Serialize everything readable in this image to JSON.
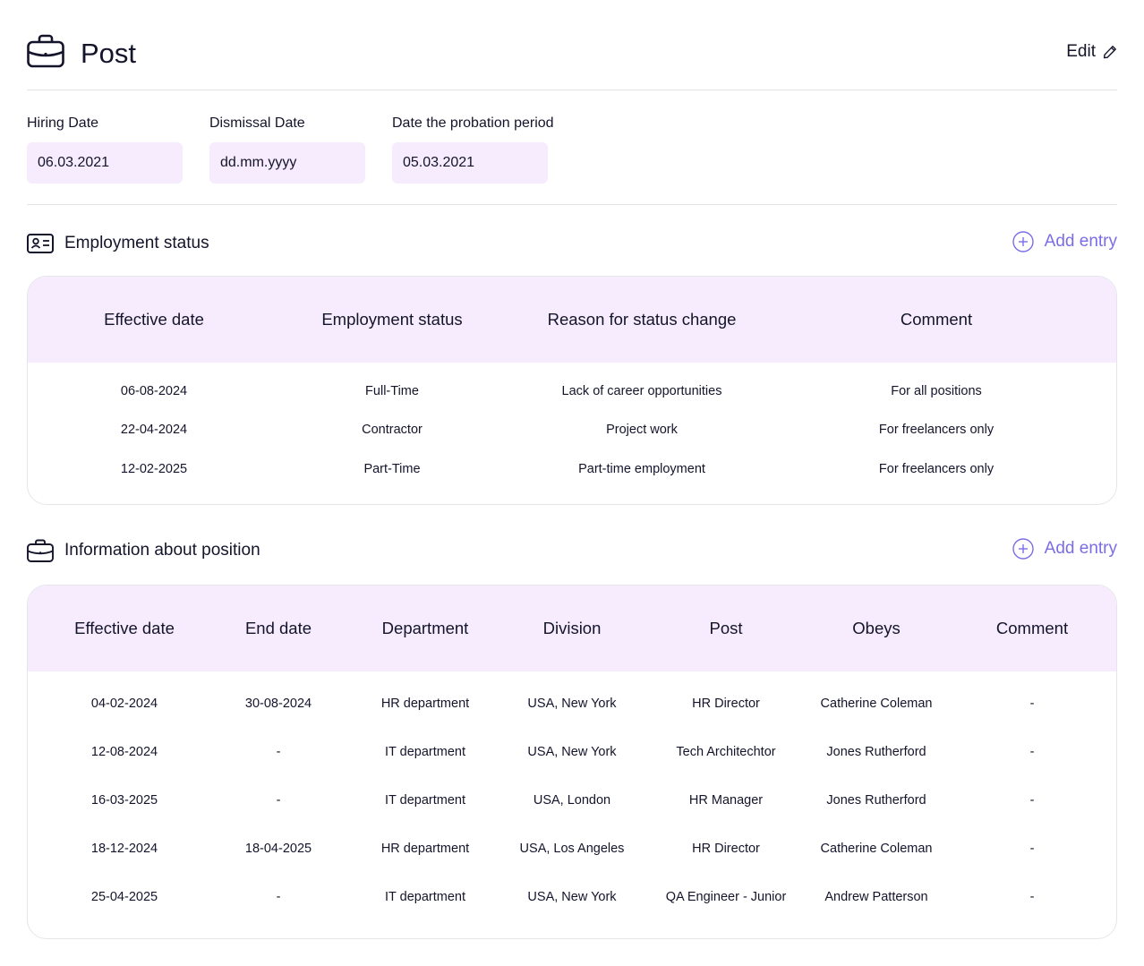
{
  "header": {
    "title": "Post",
    "edit_label": "Edit"
  },
  "dates": {
    "hiring": {
      "label": "Hiring Date",
      "value": "06.03.2021"
    },
    "dismissal": {
      "label": "Dismissal Date",
      "value": "dd.mm.yyyy"
    },
    "probation": {
      "label": "Date the probation period",
      "value": "05.03.2021"
    }
  },
  "employment_status": {
    "title": "Employment status",
    "add_label": "Add entry",
    "columns": [
      "Effective date",
      "Employment status",
      "Reason for status change",
      "Comment"
    ],
    "rows": [
      [
        "06-08-2024",
        "Full-Time",
        "Lack of career opportunities",
        "For all positions"
      ],
      [
        "22-04-2024",
        "Contractor",
        "Project work",
        "For freelancers only"
      ],
      [
        "12-02-2025",
        "Part-Time",
        "Part-time employment",
        "For freelancers only"
      ]
    ]
  },
  "position_info": {
    "title": "Information about position",
    "add_label": "Add entry",
    "columns": [
      "Effective date",
      "End date",
      "Department",
      "Division",
      "Post",
      "Obeys",
      "Comment"
    ],
    "rows": [
      [
        "04-02-2024",
        "30-08-2024",
        "HR department",
        "USA, New York",
        "HR Director",
        "Catherine Coleman",
        "-"
      ],
      [
        "12-08-2024",
        "-",
        "IT department",
        "USA, New York",
        "Tech Architechtor",
        "Jones Rutherford",
        "-"
      ],
      [
        "16-03-2025",
        "-",
        "IT department",
        "USA, London",
        "HR Manager",
        "Jones Rutherford",
        "-"
      ],
      [
        "18-12-2024",
        "18-04-2025",
        "HR department",
        "USA, Los Angeles",
        "HR Director",
        "Catherine Coleman",
        "-"
      ],
      [
        "25-04-2025",
        "-",
        "IT department",
        "USA, New York",
        "QA Engineer - Junior",
        "Andrew Patterson",
        "-"
      ]
    ]
  },
  "colors": {
    "accent": "#7a6ee6",
    "header_bg": "#f6ecfd",
    "text": "#14142b"
  }
}
